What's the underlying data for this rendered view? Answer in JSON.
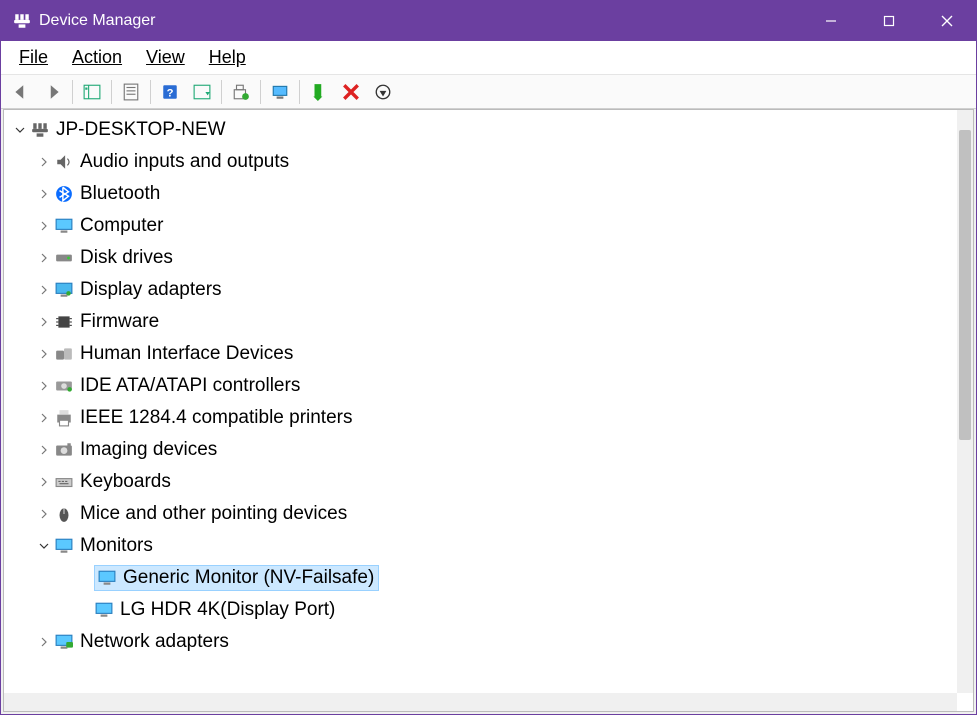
{
  "window": {
    "title": "Device Manager"
  },
  "menu": {
    "file": "File",
    "action": "Action",
    "view": "View",
    "help": "Help"
  },
  "tree": {
    "root": "JP-DESKTOP-NEW",
    "categories": [
      {
        "label": "Audio inputs and outputs",
        "icon": "speaker"
      },
      {
        "label": "Bluetooth",
        "icon": "bluetooth"
      },
      {
        "label": "Computer",
        "icon": "monitor"
      },
      {
        "label": "Disk drives",
        "icon": "disk"
      },
      {
        "label": "Display adapters",
        "icon": "display"
      },
      {
        "label": "Firmware",
        "icon": "chip"
      },
      {
        "label": "Human Interface Devices",
        "icon": "hid"
      },
      {
        "label": "IDE ATA/ATAPI controllers",
        "icon": "ide"
      },
      {
        "label": "IEEE 1284.4 compatible printers",
        "icon": "printer"
      },
      {
        "label": "Imaging devices",
        "icon": "camera"
      },
      {
        "label": "Keyboards",
        "icon": "keyboard"
      },
      {
        "label": "Mice and other pointing devices",
        "icon": "mouse"
      },
      {
        "label": "Monitors",
        "icon": "monitor",
        "expanded": true,
        "children": [
          {
            "label": "Generic Monitor (NV-Failsafe)",
            "icon": "monitor",
            "selected": true
          },
          {
            "label": "LG HDR 4K(Display Port)",
            "icon": "monitor"
          }
        ]
      },
      {
        "label": "Network adapters",
        "icon": "network"
      }
    ]
  }
}
